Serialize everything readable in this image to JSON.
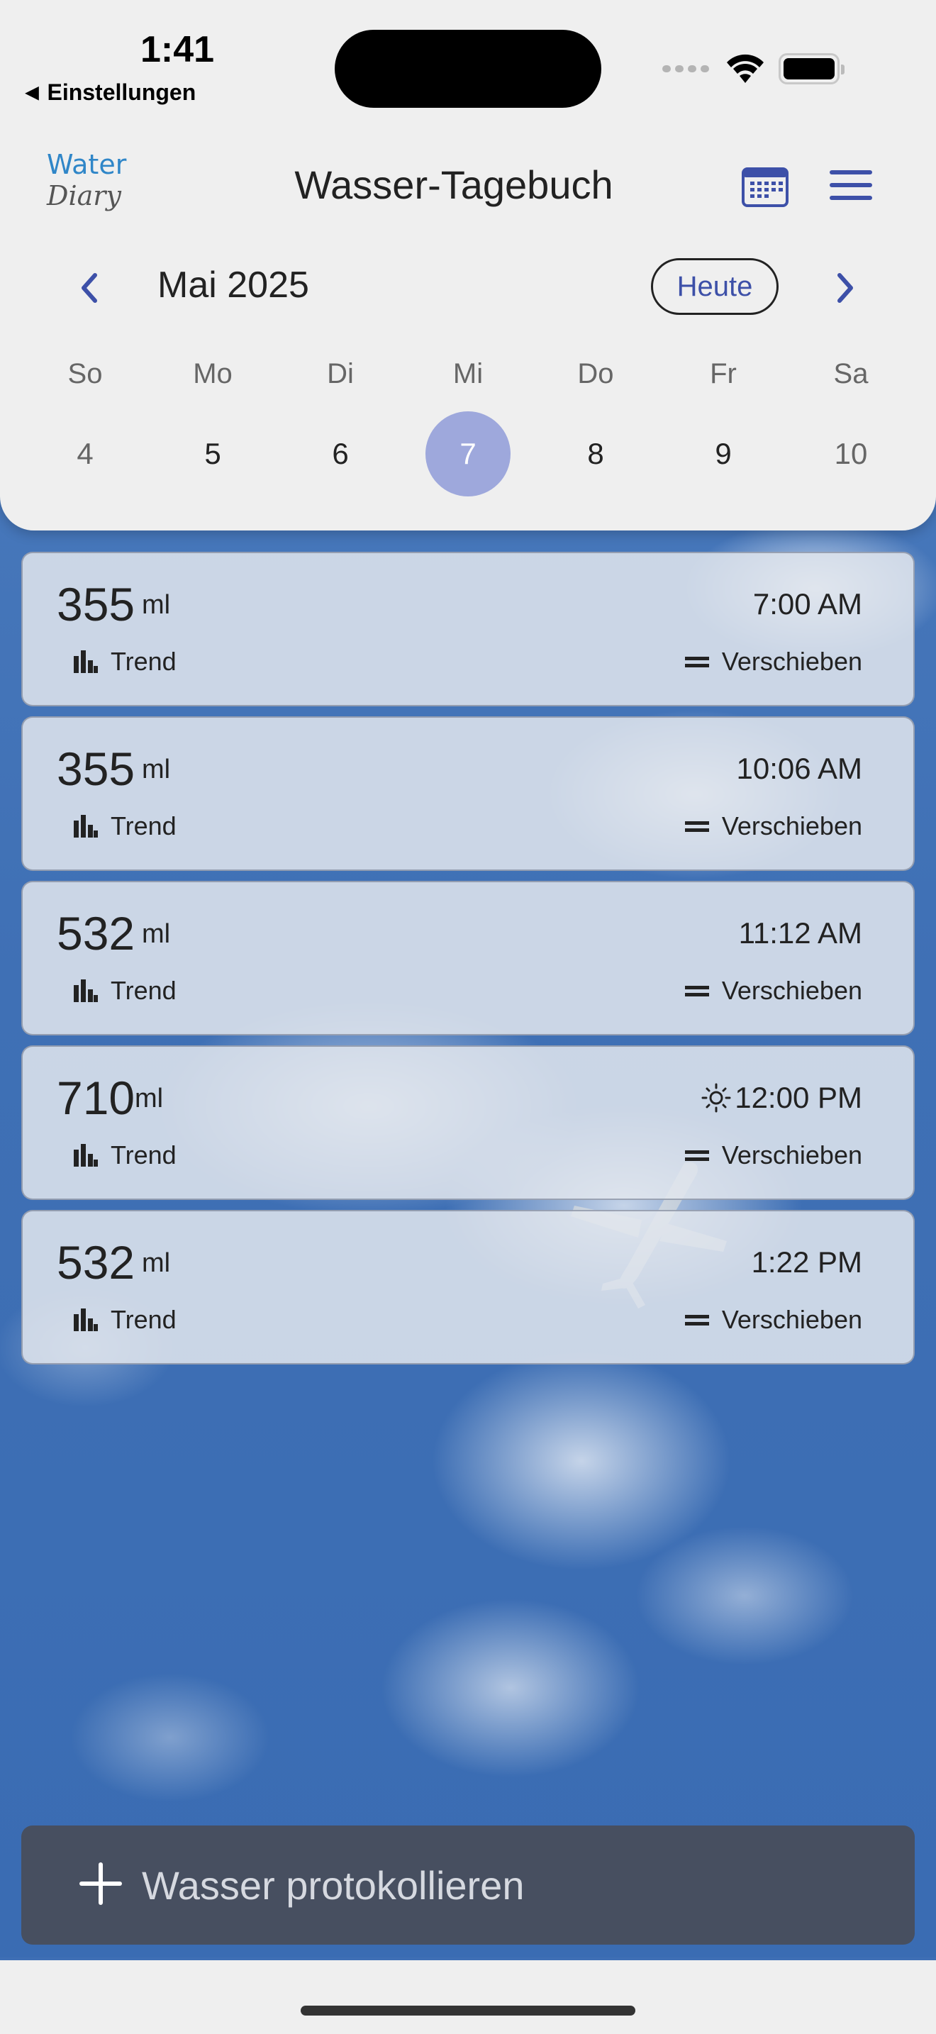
{
  "status_bar": {
    "time": "1:41",
    "back_label": "Einstellungen"
  },
  "header": {
    "logo_line1": "Water",
    "logo_line2": "Diary",
    "title": "Wasser-Tagebuch",
    "month": "Mai 2025",
    "today_label": "Heute",
    "weekdays": [
      "So",
      "Mo",
      "Di",
      "Mi",
      "Do",
      "Fr",
      "Sa"
    ],
    "days": [
      "4",
      "5",
      "6",
      "7",
      "8",
      "9",
      "10"
    ],
    "selected_day": "7"
  },
  "entries": [
    {
      "amount": "355",
      "unit": "ml",
      "time": "7:00 AM",
      "trend_label": "Trend",
      "move_label": "Verschieben"
    },
    {
      "amount": "355",
      "unit": "ml",
      "time": "10:06 AM",
      "trend_label": "Trend",
      "move_label": "Verschieben"
    },
    {
      "amount": "532",
      "unit": "ml",
      "time": "11:12 AM",
      "trend_label": "Trend",
      "move_label": "Verschieben"
    },
    {
      "amount": "710",
      "unit": "ml",
      "time": "12:00 PM",
      "time_icon": "sun-icon",
      "trend_label": "Trend",
      "move_label": "Verschieben"
    },
    {
      "amount": "532",
      "unit": "ml",
      "time": "1:22 PM",
      "trend_label": "Trend",
      "move_label": "Verschieben"
    }
  ],
  "log_button": {
    "label": "Wasser protokollieren"
  },
  "colors": {
    "accent": "#3d50a8",
    "selected_day": "#9ea8dc",
    "header_bg": "#efefef",
    "log_button_bg": "#484e5c"
  }
}
